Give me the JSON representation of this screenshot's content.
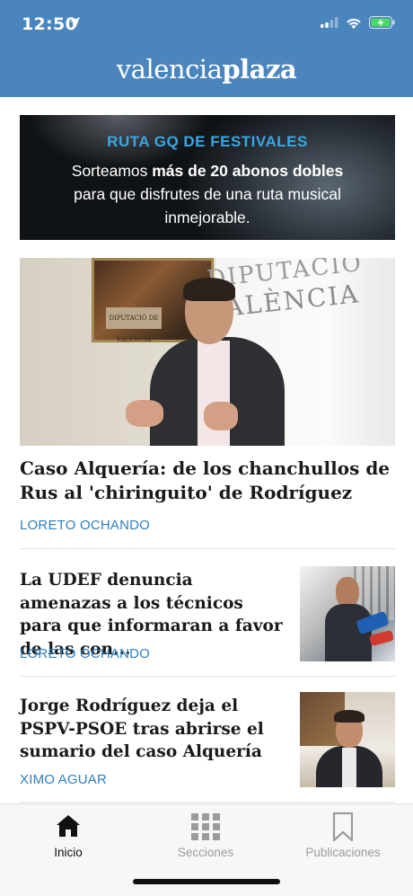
{
  "status_bar": {
    "time": "12:50",
    "location_icon": "location-arrow-icon",
    "signal_icon": "signal-bars-icon",
    "wifi_icon": "wifi-icon",
    "battery_icon": "battery-charging-icon"
  },
  "header": {
    "logo_regular": "valencia",
    "logo_bold": "plaza",
    "background_color": "#4a86bd"
  },
  "banner": {
    "title": "RUTA GQ DE FESTIVALES",
    "line1_prefix": "Sorteamos ",
    "line1_bold": "más de 20 abonos dobles",
    "line2": "para que disfrutes de una ruta musical",
    "line3": "inmejorable."
  },
  "hero_image": {
    "plaque_text": "DIPUTACIÓ DE VALÈNCIA",
    "banner_text_1": "DIPUTACIÓ",
    "banner_text_2": "VALÈNCIA"
  },
  "articles": [
    {
      "title": "Caso Alquería: de los chanchullos de Rus al 'chiringuito' de Rodríguez",
      "author": "LORETO OCHANDO"
    },
    {
      "title": "La UDEF denuncia amenazas a los técnicos para que informaran a favor de las con...",
      "author": "LORETO OCHANDO"
    },
    {
      "title": "Jorge Rodríguez deja el PSPV-PSOE tras abrirse el sumario del caso Alquería",
      "author": "XIMO AGUAR"
    }
  ],
  "tabbar": {
    "tabs": [
      {
        "label": "Inicio",
        "icon": "home-icon",
        "active": true
      },
      {
        "label": "Secciones",
        "icon": "grid-icon",
        "active": false
      },
      {
        "label": "Publicaciones",
        "icon": "bookmark-icon",
        "active": false
      }
    ],
    "active_color": "#111111",
    "inactive_color": "#9b9b9b"
  },
  "colors": {
    "author": "#2f7fbf",
    "banner_title": "#3aa7e0",
    "battery_green": "#4cd964"
  }
}
